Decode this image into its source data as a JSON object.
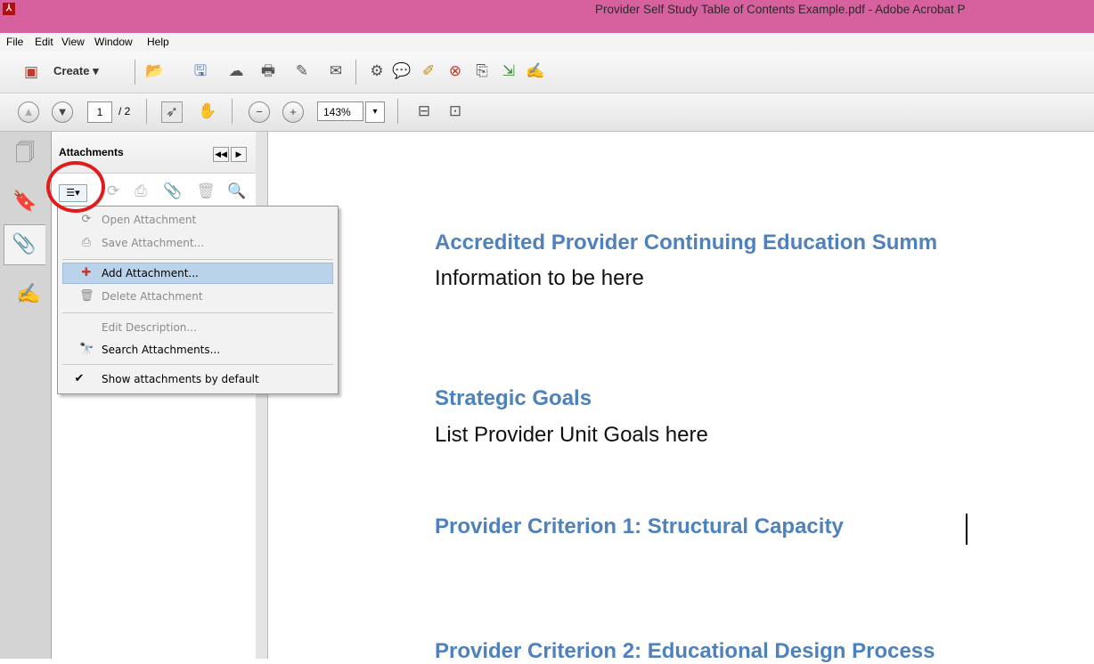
{
  "window": {
    "title": "Provider Self Study Table of Contents Example.pdf - Adobe Acrobat P",
    "app_icon_glyph": "⅄"
  },
  "menubar": {
    "items": [
      "File",
      "Edit",
      "View",
      "Window",
      "Help"
    ]
  },
  "toolbar1": {
    "create_label": "Create ▾"
  },
  "toolbar2": {
    "page_current": "1",
    "page_total": "/ 2",
    "zoom": "143%"
  },
  "panel": {
    "title": "Attachments"
  },
  "context_menu": {
    "items": [
      {
        "label": "Open Attachment",
        "enabled": false
      },
      {
        "label": "Save Attachment...",
        "enabled": false
      },
      {
        "label": "Add Attachment...",
        "enabled": true,
        "highlighted": true
      },
      {
        "label": "Delete Attachment",
        "enabled": false
      },
      {
        "label": "Edit Description...",
        "enabled": false
      },
      {
        "label": "Search Attachments...",
        "enabled": true
      },
      {
        "label": "Show attachments by default",
        "enabled": true,
        "checked": true
      }
    ],
    "check_glyph": "✔"
  },
  "document": {
    "heading1": "Accredited Provider Continuing Education Summ",
    "body1": "Information to be here",
    "heading2": "Strategic Goals",
    "body2": "List Provider Unit Goals here",
    "heading3": "Provider Criterion 1: Structural Capacity",
    "heading4": "Provider Criterion 2: Educational Design Process"
  },
  "colors": {
    "titlebar": "#d7619f",
    "heading": "#4f81bd",
    "highlight": "#bad3ea",
    "annotation_circle": "#e21b1b"
  }
}
